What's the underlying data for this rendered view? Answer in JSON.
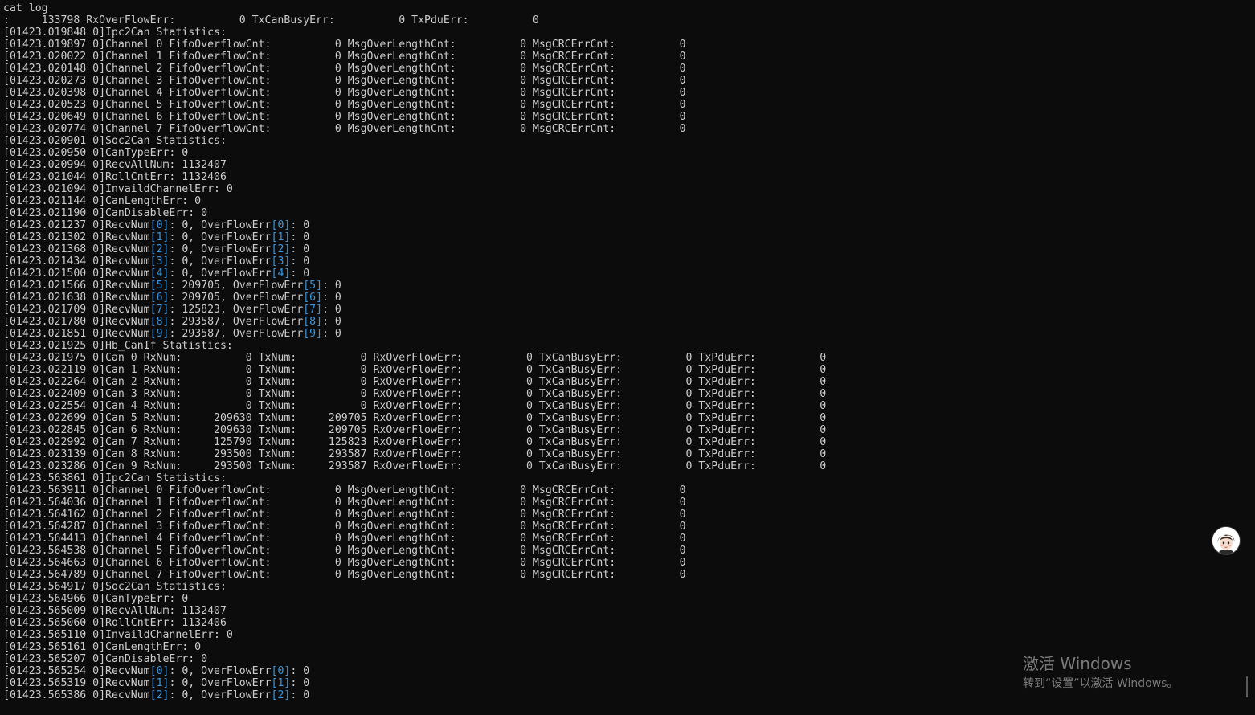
{
  "terminal": {
    "lines": [
      "cat log",
      ":     133798 RxOverFlowErr:          0 TxCanBusyErr:          0 TxPduErr:          0",
      "[01423.019848 0]Ipc2Can Statistics:",
      "[01423.019897 0]Channel 0 FifoOverflowCnt:          0 MsgOverLengthCnt:          0 MsgCRCErrCnt:          0",
      "[01423.020022 0]Channel 1 FifoOverflowCnt:          0 MsgOverLengthCnt:          0 MsgCRCErrCnt:          0",
      "[01423.020148 0]Channel 2 FifoOverflowCnt:          0 MsgOverLengthCnt:          0 MsgCRCErrCnt:          0",
      "[01423.020273 0]Channel 3 FifoOverflowCnt:          0 MsgOverLengthCnt:          0 MsgCRCErrCnt:          0",
      "[01423.020398 0]Channel 4 FifoOverflowCnt:          0 MsgOverLengthCnt:          0 MsgCRCErrCnt:          0",
      "[01423.020523 0]Channel 5 FifoOverflowCnt:          0 MsgOverLengthCnt:          0 MsgCRCErrCnt:          0",
      "[01423.020649 0]Channel 6 FifoOverflowCnt:          0 MsgOverLengthCnt:          0 MsgCRCErrCnt:          0",
      "[01423.020774 0]Channel 7 FifoOverflowCnt:          0 MsgOverLengthCnt:          0 MsgCRCErrCnt:          0",
      "[01423.020901 0]Soc2Can Statistics:",
      "[01423.020950 0]CanTypeErr: 0",
      "[01423.020994 0]RecvAllNum: 1132407",
      "[01423.021044 0]RollCntErr: 1132406",
      "[01423.021094 0]InvaildChannelErr: 0",
      "[01423.021144 0]CanLengthErr: 0",
      "[01423.021190 0]CanDisableErr: 0",
      "[01423.021237 0]RecvNum[0]: 0, OverFlowErr[0]: 0",
      "[01423.021302 0]RecvNum[1]: 0, OverFlowErr[1]: 0",
      "[01423.021368 0]RecvNum[2]: 0, OverFlowErr[2]: 0",
      "[01423.021434 0]RecvNum[3]: 0, OverFlowErr[3]: 0",
      "[01423.021500 0]RecvNum[4]: 0, OverFlowErr[4]: 0",
      "[01423.021566 0]RecvNum[5]: 209705, OverFlowErr[5]: 0",
      "[01423.021638 0]RecvNum[6]: 209705, OverFlowErr[6]: 0",
      "[01423.021709 0]RecvNum[7]: 125823, OverFlowErr[7]: 0",
      "[01423.021780 0]RecvNum[8]: 293587, OverFlowErr[8]: 0",
      "[01423.021851 0]RecvNum[9]: 293587, OverFlowErr[9]: 0",
      "[01423.021925 0]Hb_CanIf Statistics:",
      "[01423.021975 0]Can 0 RxNum:          0 TxNum:          0 RxOverFlowErr:          0 TxCanBusyErr:          0 TxPduErr:          0",
      "[01423.022119 0]Can 1 RxNum:          0 TxNum:          0 RxOverFlowErr:          0 TxCanBusyErr:          0 TxPduErr:          0",
      "[01423.022264 0]Can 2 RxNum:          0 TxNum:          0 RxOverFlowErr:          0 TxCanBusyErr:          0 TxPduErr:          0",
      "[01423.022409 0]Can 3 RxNum:          0 TxNum:          0 RxOverFlowErr:          0 TxCanBusyErr:          0 TxPduErr:          0",
      "[01423.022554 0]Can 4 RxNum:          0 TxNum:          0 RxOverFlowErr:          0 TxCanBusyErr:          0 TxPduErr:          0",
      "[01423.022699 0]Can 5 RxNum:     209630 TxNum:     209705 RxOverFlowErr:          0 TxCanBusyErr:          0 TxPduErr:          0",
      "[01423.022845 0]Can 6 RxNum:     209630 TxNum:     209705 RxOverFlowErr:          0 TxCanBusyErr:          0 TxPduErr:          0",
      "[01423.022992 0]Can 7 RxNum:     125790 TxNum:     125823 RxOverFlowErr:          0 TxCanBusyErr:          0 TxPduErr:          0",
      "[01423.023139 0]Can 8 RxNum:     293500 TxNum:     293587 RxOverFlowErr:          0 TxCanBusyErr:          0 TxPduErr:          0",
      "[01423.023286 0]Can 9 RxNum:     293500 TxNum:     293587 RxOverFlowErr:          0 TxCanBusyErr:          0 TxPduErr:          0",
      "[01423.563861 0]Ipc2Can Statistics:",
      "[01423.563911 0]Channel 0 FifoOverflowCnt:          0 MsgOverLengthCnt:          0 MsgCRCErrCnt:          0",
      "[01423.564036 0]Channel 1 FifoOverflowCnt:          0 MsgOverLengthCnt:          0 MsgCRCErrCnt:          0",
      "[01423.564162 0]Channel 2 FifoOverflowCnt:          0 MsgOverLengthCnt:          0 MsgCRCErrCnt:          0",
      "[01423.564287 0]Channel 3 FifoOverflowCnt:          0 MsgOverLengthCnt:          0 MsgCRCErrCnt:          0",
      "[01423.564413 0]Channel 4 FifoOverflowCnt:          0 MsgOverLengthCnt:          0 MsgCRCErrCnt:          0",
      "[01423.564538 0]Channel 5 FifoOverflowCnt:          0 MsgOverLengthCnt:          0 MsgCRCErrCnt:          0",
      "[01423.564663 0]Channel 6 FifoOverflowCnt:          0 MsgOverLengthCnt:          0 MsgCRCErrCnt:          0",
      "[01423.564789 0]Channel 7 FifoOverflowCnt:          0 MsgOverLengthCnt:          0 MsgCRCErrCnt:          0",
      "[01423.564917 0]Soc2Can Statistics:",
      "[01423.564966 0]CanTypeErr: 0",
      "[01423.565009 0]RecvAllNum: 1132407",
      "[01423.565060 0]RollCntErr: 1132406",
      "[01423.565110 0]InvaildChannelErr: 0",
      "[01423.565161 0]CanLengthErr: 0",
      "[01423.565207 0]CanDisableErr: 0",
      "[01423.565254 0]RecvNum[0]: 0, OverFlowErr[0]: 0",
      "[01423.565319 0]RecvNum[1]: 0, OverFlowErr[1]: 0",
      "[01423.565386 0]RecvNum[2]: 0, OverFlowErr[2]: 0"
    ]
  },
  "watermark": {
    "title": "激活 Windows",
    "subtitle": "转到“设置”以激活 Windows。"
  },
  "colors": {
    "background": "#0c0c0c",
    "foreground": "#cccccc",
    "index_highlight": "#3a96dd",
    "watermark": "#7a7a7a"
  },
  "icons": {
    "floating_avatar": "avatar-icon"
  }
}
